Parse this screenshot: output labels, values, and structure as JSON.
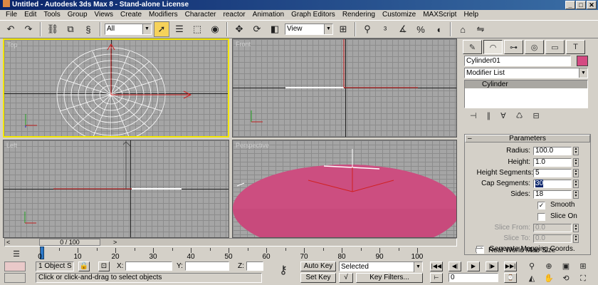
{
  "window": {
    "title": "Untitled - Autodesk 3ds Max 8 - Stand-alone License",
    "controls": [
      "_",
      "□",
      "✕"
    ]
  },
  "menu": [
    "File",
    "Edit",
    "Tools",
    "Group",
    "Views",
    "Create",
    "Modifiers",
    "Character",
    "reactor",
    "Animation",
    "Graph Editors",
    "Rendering",
    "Customize",
    "MAXScript",
    "Help"
  ],
  "toolbar": {
    "selection_filter": "All",
    "reference_coord": "View"
  },
  "viewports": {
    "top": {
      "label": "Top"
    },
    "front": {
      "label": "Front"
    },
    "left": {
      "label": "Left"
    },
    "perspective": {
      "label": "Perspective"
    }
  },
  "command_panel": {
    "object_name": "Cylinder01",
    "object_color": "#d44a82",
    "modifier_list": "Modifier List",
    "stack_item": "Cylinder",
    "parameters": {
      "header": "Parameters",
      "radius_label": "Radius:",
      "radius_value": "100.0",
      "height_label": "Height:",
      "height_value": "1.0",
      "height_segments_label": "Height Segments:",
      "height_segments_value": "5",
      "cap_segments_label": "Cap Segments:",
      "cap_segments_value": "30",
      "sides_label": "Sides:",
      "sides_value": "18",
      "smooth_label": "Smooth",
      "smooth_checked": true,
      "slice_on_label": "Slice On",
      "slice_on_checked": false,
      "slice_from_label": "Slice From:",
      "slice_from_value": "0.0",
      "slice_to_label": "Slice To:",
      "slice_to_value": "0.0",
      "gen_mapping_label": "Generate Mapping Coords.",
      "gen_mapping_checked": true,
      "real_world_label": "Real-World Map Size",
      "real_world_checked": false
    }
  },
  "timeline": {
    "slider_label": "0 / 100",
    "ticks": [
      "0",
      "10",
      "20",
      "30",
      "40",
      "50",
      "60",
      "70",
      "80",
      "90",
      "100"
    ]
  },
  "status": {
    "selection_count": "1 Object S",
    "prompt": "Click or click-and-drag to select objects",
    "x_label": "X:",
    "y_label": "Y:",
    "z_label": "Z:",
    "auto_key": "Auto Key",
    "set_key": "Set Key",
    "key_mode": "Selected",
    "key_filters": "Key Filters...",
    "frame": "0"
  }
}
